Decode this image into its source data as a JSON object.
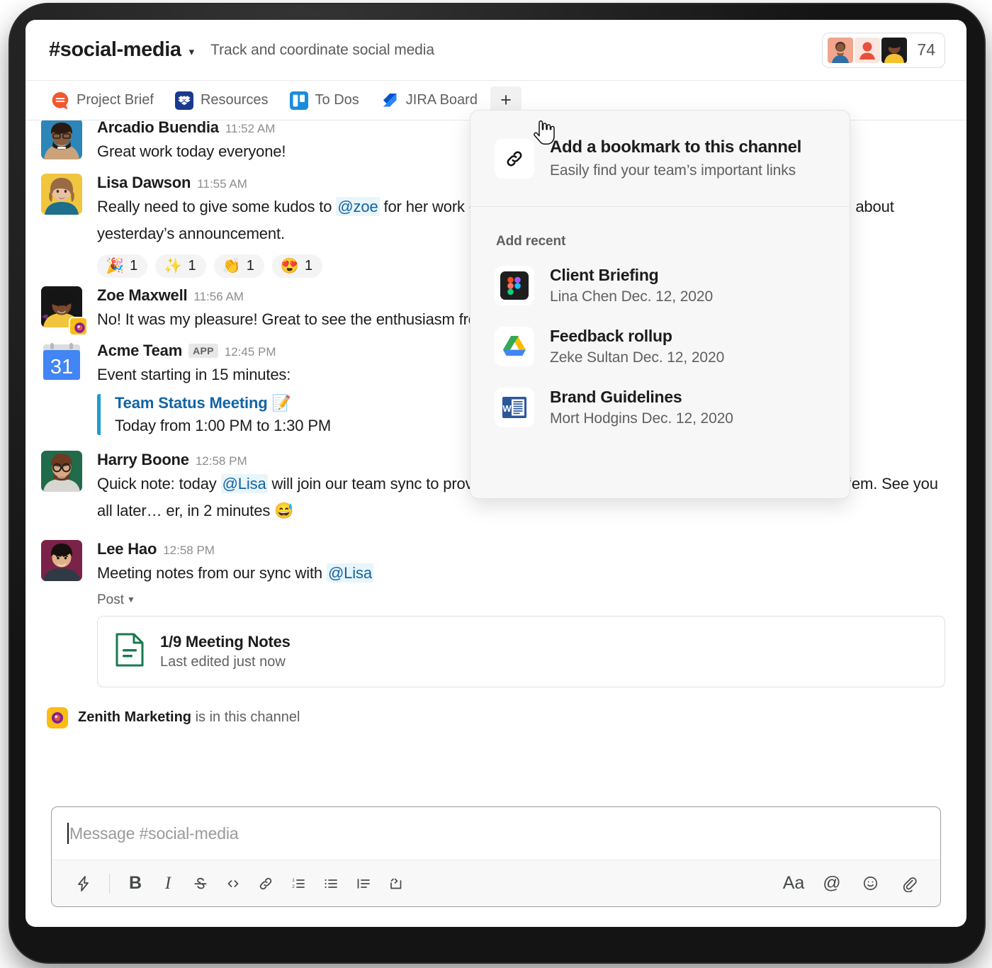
{
  "header": {
    "channel_name": "#social-media",
    "chevron": "chevron-down-icon",
    "topic": "Track and coordinate social media",
    "member_count": "74"
  },
  "bookmarks": {
    "items": [
      {
        "label": "Project Brief",
        "icon": "quip-icon"
      },
      {
        "label": "Resources",
        "icon": "dropbox-icon"
      },
      {
        "label": "To Dos",
        "icon": "trello-icon"
      },
      {
        "label": "JIRA Board",
        "icon": "jira-icon"
      }
    ],
    "add_label": "+"
  },
  "bookmark_panel": {
    "add_bookmark_title": "Add a bookmark to this channel",
    "add_bookmark_sub": "Easily find your team’s important links",
    "add_bookmark_icon": "link-icon",
    "section_label": "Add recent",
    "recent": [
      {
        "name": "Client Briefing",
        "sub": "Lina Chen Dec. 12, 2020",
        "icon": "figma-icon"
      },
      {
        "name": "Feedback rollup",
        "sub": "Zeke Sultan Dec. 12, 2020",
        "icon": "google-drive-icon"
      },
      {
        "name": "Brand Guidelines",
        "sub": "Mort Hodgins Dec. 12, 2020",
        "icon": "word-icon"
      }
    ]
  },
  "messages": [
    {
      "author": "Arcadio Buendia",
      "time": "11:52 AM",
      "text": "Great work today everyone!"
    },
    {
      "author": "Lisa Dawson",
      "time": "11:55 AM",
      "text_before": "Really need to give some kudos to ",
      "mention": "@zoe",
      "text_after": " for her work on the launch yesterday. People are really, really excited about yesterday’s announcement.",
      "reactions": [
        {
          "emoji": "🎉",
          "count": "1"
        },
        {
          "emoji": "✨",
          "count": "1"
        },
        {
          "emoji": "👏",
          "count": "1"
        },
        {
          "emoji": "😍",
          "count": "1"
        }
      ]
    },
    {
      "author": "Zoe Maxwell",
      "time": "11:56 AM",
      "text": "No! It was my pleasure! Great to see the enthusiasm from the whole team."
    },
    {
      "author": "Acme Team",
      "app_tag": "APP",
      "time": "12:45 PM",
      "text": "Event starting in 15 minutes:",
      "event_title": "Team Status Meeting 📝",
      "event_when": "Today from 1:00 PM to 1:30 PM"
    },
    {
      "author": "Harry Boone",
      "time": "12:58 PM",
      "text_before": "Quick note: today ",
      "mention": "@Lisa",
      "text_after": " will join our team sync to provide updates on the launch. if you have questions, bring ‘em. See you all later… er, in 2 minutes 😅"
    },
    {
      "author": "Lee Hao",
      "time": "12:58 PM",
      "text_before": "Meeting notes from our sync with ",
      "mention": "@Lisa",
      "text_after": "",
      "post_kind": "Post",
      "post_name": "1/9 Meeting Notes",
      "post_sub": "Last edited just now",
      "post_icon": "document-icon"
    }
  ],
  "notice": {
    "app_name": "Zenith Marketing",
    "rest": " is in this channel",
    "icon": "zenith-icon"
  },
  "composer": {
    "placeholder": "Message #social-media",
    "tools_left": [
      {
        "name": "shortcuts-icon",
        "glyph": ""
      },
      {
        "name": "bold-icon",
        "glyph": "B"
      },
      {
        "name": "italic-icon",
        "glyph": "I"
      },
      {
        "name": "strikethrough-icon",
        "glyph": ""
      },
      {
        "name": "code-icon",
        "glyph": ""
      },
      {
        "name": "link-icon",
        "glyph": ""
      },
      {
        "name": "ordered-list-icon",
        "glyph": ""
      },
      {
        "name": "bulleted-list-icon",
        "glyph": ""
      },
      {
        "name": "blockquote-icon",
        "glyph": ""
      },
      {
        "name": "code-block-icon",
        "glyph": ""
      }
    ],
    "tools_right": [
      {
        "name": "formatting-icon",
        "glyph": "Aa"
      },
      {
        "name": "mention-icon",
        "glyph": "@"
      },
      {
        "name": "emoji-icon",
        "glyph": ""
      },
      {
        "name": "attachment-icon",
        "glyph": ""
      }
    ]
  },
  "colors": {
    "accent_blue": "#1264a3",
    "mention_bg": "#e8f5fa",
    "event_bar": "#1d9bd1",
    "panel_bg": "#f7f7f7"
  }
}
